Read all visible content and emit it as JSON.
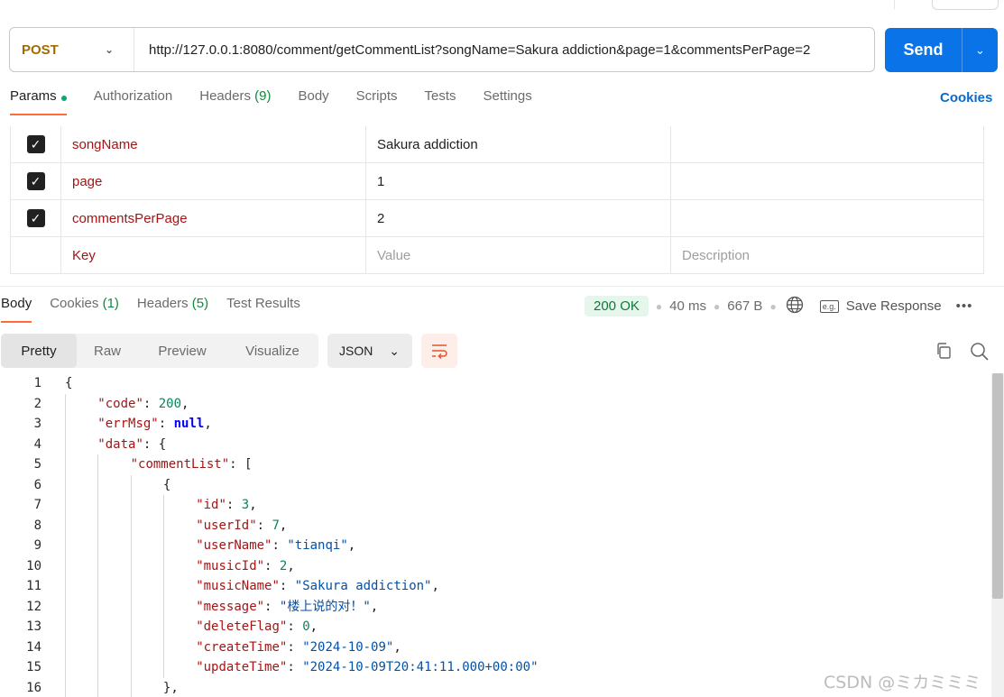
{
  "request": {
    "method": "POST",
    "url": "http://127.0.0.1:8080/comment/getCommentList?songName=Sakura addiction&page=1&commentsPerPage=2",
    "send_label": "Send"
  },
  "req_tabs": {
    "params": "Params",
    "authorization": "Authorization",
    "headers": "Headers",
    "headers_count": "(9)",
    "body": "Body",
    "scripts": "Scripts",
    "tests": "Tests",
    "settings": "Settings",
    "cookies": "Cookies"
  },
  "params": [
    {
      "key": "songName",
      "value": "Sakura addiction",
      "checked": true
    },
    {
      "key": "page",
      "value": "1",
      "checked": true
    },
    {
      "key": "commentsPerPage",
      "value": "2",
      "checked": true
    }
  ],
  "params_placeholder": {
    "key": "Key",
    "value": "Value",
    "description": "Description"
  },
  "res_tabs": {
    "body": "Body",
    "cookies": "Cookies",
    "cookies_count": "(1)",
    "headers": "Headers",
    "headers_count": "(5)",
    "test_results": "Test Results"
  },
  "status": {
    "code": "200 OK",
    "time": "40 ms",
    "size": "667 B",
    "save_response": "Save Response"
  },
  "format_tabs": {
    "pretty": "Pretty",
    "raw": "Raw",
    "preview": "Preview",
    "visualize": "Visualize",
    "language": "JSON"
  },
  "code_lines": [
    {
      "n": "1",
      "indent": 0,
      "parts": [
        [
          "p",
          "{"
        ]
      ]
    },
    {
      "n": "2",
      "indent": 1,
      "parts": [
        [
          "k",
          "\"code\""
        ],
        [
          "p",
          ": "
        ],
        [
          "n",
          "200"
        ],
        [
          "p",
          ","
        ]
      ]
    },
    {
      "n": "3",
      "indent": 1,
      "parts": [
        [
          "k",
          "\"errMsg\""
        ],
        [
          "p",
          ": "
        ],
        [
          "kw",
          "null"
        ],
        [
          "p",
          ","
        ]
      ]
    },
    {
      "n": "4",
      "indent": 1,
      "parts": [
        [
          "k",
          "\"data\""
        ],
        [
          "p",
          ": {"
        ]
      ]
    },
    {
      "n": "5",
      "indent": 2,
      "parts": [
        [
          "k",
          "\"commentList\""
        ],
        [
          "p",
          ": ["
        ]
      ]
    },
    {
      "n": "6",
      "indent": 3,
      "parts": [
        [
          "p",
          "{"
        ]
      ]
    },
    {
      "n": "7",
      "indent": 4,
      "parts": [
        [
          "k",
          "\"id\""
        ],
        [
          "p",
          ": "
        ],
        [
          "n",
          "3"
        ],
        [
          "p",
          ","
        ]
      ]
    },
    {
      "n": "8",
      "indent": 4,
      "parts": [
        [
          "k",
          "\"userId\""
        ],
        [
          "p",
          ": "
        ],
        [
          "n",
          "7"
        ],
        [
          "p",
          ","
        ]
      ]
    },
    {
      "n": "9",
      "indent": 4,
      "parts": [
        [
          "k",
          "\"userName\""
        ],
        [
          "p",
          ": "
        ],
        [
          "s",
          "\"tianqi\""
        ],
        [
          "p",
          ","
        ]
      ]
    },
    {
      "n": "10",
      "indent": 4,
      "parts": [
        [
          "k",
          "\"musicId\""
        ],
        [
          "p",
          ": "
        ],
        [
          "n",
          "2"
        ],
        [
          "p",
          ","
        ]
      ]
    },
    {
      "n": "11",
      "indent": 4,
      "parts": [
        [
          "k",
          "\"musicName\""
        ],
        [
          "p",
          ": "
        ],
        [
          "s",
          "\"Sakura addiction\""
        ],
        [
          "p",
          ","
        ]
      ]
    },
    {
      "n": "12",
      "indent": 4,
      "parts": [
        [
          "k",
          "\"message\""
        ],
        [
          "p",
          ": "
        ],
        [
          "s",
          "\"楼上说的对！\""
        ],
        [
          "p",
          ","
        ]
      ]
    },
    {
      "n": "13",
      "indent": 4,
      "parts": [
        [
          "k",
          "\"deleteFlag\""
        ],
        [
          "p",
          ": "
        ],
        [
          "n",
          "0"
        ],
        [
          "p",
          ","
        ]
      ]
    },
    {
      "n": "14",
      "indent": 4,
      "parts": [
        [
          "k",
          "\"createTime\""
        ],
        [
          "p",
          ": "
        ],
        [
          "s",
          "\"2024-10-09\""
        ],
        [
          "p",
          ","
        ]
      ]
    },
    {
      "n": "15",
      "indent": 4,
      "parts": [
        [
          "k",
          "\"updateTime\""
        ],
        [
          "p",
          ": "
        ],
        [
          "s",
          "\"2024-10-09T20:41:11.000+00:00\""
        ]
      ]
    },
    {
      "n": "16",
      "indent": 3,
      "parts": [
        [
          "p",
          "},"
        ]
      ]
    }
  ],
  "watermark": "CSDN @ミカミミミ",
  "colors": {
    "send": "#0b73e8",
    "accent": "#ff6c37",
    "status_ok": "#0d7a35"
  }
}
